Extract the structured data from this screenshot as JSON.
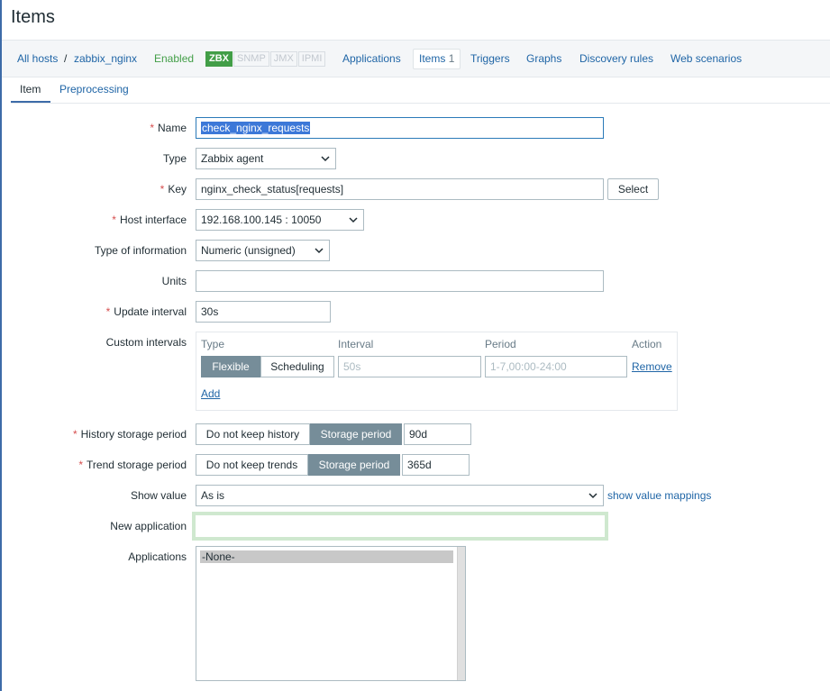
{
  "page": {
    "title": "Items"
  },
  "navbar": {
    "all_hosts": "All hosts",
    "separator": "/",
    "host": "zabbix_nginx",
    "status": "Enabled",
    "badges": [
      "ZBX",
      "SNMP",
      "JMX",
      "IPMI"
    ],
    "active_badge": "ZBX",
    "links": {
      "applications": "Applications",
      "items": "Items",
      "items_count": "1",
      "triggers": "Triggers",
      "graphs": "Graphs",
      "discovery_rules": "Discovery rules",
      "web_scenarios": "Web scenarios"
    },
    "status_color": "#429e47"
  },
  "subtabs": {
    "item": "Item",
    "preprocessing": "Preprocessing",
    "active": "Item"
  },
  "form": {
    "required_mark": "*",
    "name": {
      "label": "Name",
      "value": "check_nginx_requests"
    },
    "type": {
      "label": "Type",
      "value": "Zabbix agent"
    },
    "key": {
      "label": "Key",
      "value": "nginx_check_status[requests]",
      "select_button": "Select"
    },
    "host_interface": {
      "label": "Host interface",
      "value": "192.168.100.145 : 10050"
    },
    "type_of_information": {
      "label": "Type of information",
      "value": "Numeric (unsigned)"
    },
    "units": {
      "label": "Units",
      "value": ""
    },
    "update_interval": {
      "label": "Update interval",
      "value": "30s"
    },
    "custom_intervals": {
      "label": "Custom intervals",
      "columns": {
        "type": "Type",
        "interval": "Interval",
        "period": "Period",
        "action": "Action"
      },
      "row": {
        "flexible": "Flexible",
        "scheduling": "Scheduling",
        "interval_placeholder": "50s",
        "period_placeholder": "1-7,00:00-24:00",
        "remove": "Remove"
      },
      "add": "Add"
    },
    "history": {
      "label": "History storage period",
      "off_option": "Do not keep history",
      "on_option": "Storage period",
      "value": "90d"
    },
    "trend": {
      "label": "Trend storage period",
      "off_option": "Do not keep trends",
      "on_option": "Storage period",
      "value": "365d"
    },
    "show_value": {
      "label": "Show value",
      "value": "As is",
      "mappings_link": "show value mappings"
    },
    "new_application": {
      "label": "New application",
      "value": ""
    },
    "applications": {
      "label": "Applications",
      "options": [
        "-None-"
      ]
    }
  }
}
